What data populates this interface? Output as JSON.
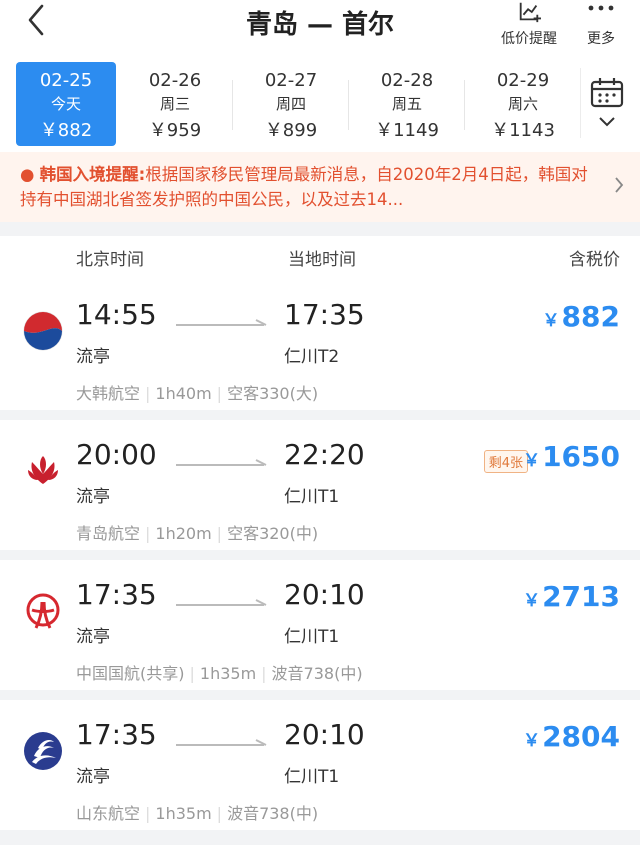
{
  "header": {
    "title": "青岛 — 首尔",
    "price_alert_label": "低价提醒",
    "more_label": "更多"
  },
  "dates": [
    {
      "date": "02-25",
      "weekday": "今天",
      "price": "￥882",
      "active": true
    },
    {
      "date": "02-26",
      "weekday": "周三",
      "price": "￥959"
    },
    {
      "date": "02-27",
      "weekday": "周四",
      "price": "￥899"
    },
    {
      "date": "02-28",
      "weekday": "周五",
      "price": "￥1149"
    },
    {
      "date": "02-29",
      "weekday": "周六",
      "price": "￥1143"
    }
  ],
  "notice": {
    "title": "韩国入境提醒:",
    "text": "根据国家移民管理局最新消息，自2020年2月4日起，韩国对持有中国湖北省签发护照的中国公民，以及过去14..."
  },
  "columns": {
    "beijing_time": "北京时间",
    "local_time": "当地时间",
    "tax_price": "含税价"
  },
  "flights": [
    {
      "airline_icon": "korean-air-logo",
      "dep_time": "14:55",
      "arr_time": "17:35",
      "dep_airport": "流亭",
      "arr_airport": "仁川T2",
      "airline": "大韩航空",
      "duration": "1h40m",
      "aircraft": "空客330(大)",
      "currency": "￥",
      "price": "882",
      "badge": ""
    },
    {
      "airline_icon": "qingdao-airlines-logo",
      "dep_time": "20:00",
      "arr_time": "22:20",
      "dep_airport": "流亭",
      "arr_airport": "仁川T1",
      "airline": "青岛航空",
      "duration": "1h20m",
      "aircraft": "空客320(中)",
      "currency": "￥",
      "price": "1650",
      "badge": "剩4张"
    },
    {
      "airline_icon": "air-china-logo",
      "dep_time": "17:35",
      "arr_time": "20:10",
      "dep_airport": "流亭",
      "arr_airport": "仁川T1",
      "airline": "中国国航(共享)",
      "duration": "1h35m",
      "aircraft": "波音738(中)",
      "currency": "￥",
      "price": "2713",
      "badge": ""
    },
    {
      "airline_icon": "shandong-airlines-logo",
      "dep_time": "17:35",
      "arr_time": "20:10",
      "dep_airport": "流亭",
      "arr_airport": "仁川T1",
      "airline": "山东航空",
      "duration": "1h35m",
      "aircraft": "波音738(中)",
      "currency": "￥",
      "price": "2804",
      "badge": ""
    }
  ],
  "colors": {
    "accent": "#2c8cf0",
    "notice_text": "#e2502f",
    "notice_bg": "#fff4ee",
    "badge": "#e07a3c"
  }
}
